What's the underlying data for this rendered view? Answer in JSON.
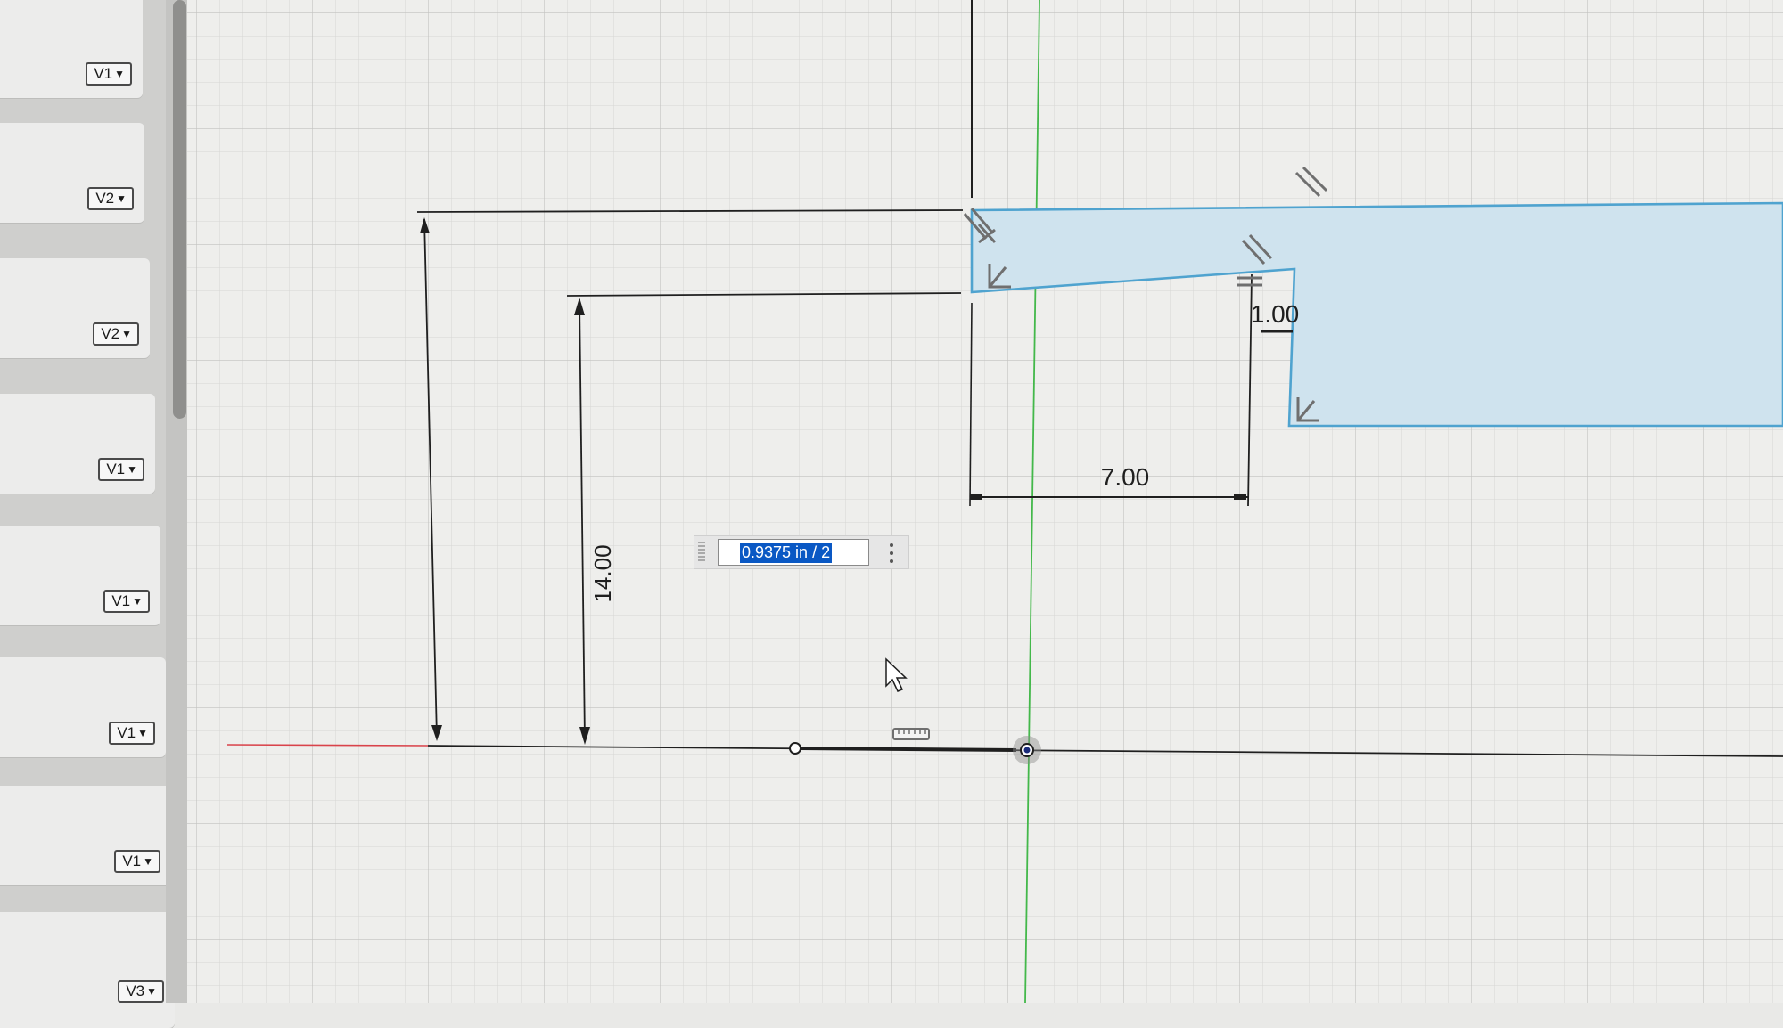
{
  "sidebar": {
    "versions": [
      "V1",
      "V2",
      "V2",
      "V1",
      "V1",
      "V1",
      "V1",
      "V3"
    ],
    "caret_icon": "triangle-down-icon"
  },
  "sketch": {
    "dimensions": {
      "vertical_overall": "14.00",
      "horizontal_lower": "7.00",
      "horizontal_small": "1.00"
    },
    "value_editor": {
      "value": "0.9375 in / 2",
      "menu_icon": "vertical-ellipsis-icon"
    },
    "colors": {
      "x_axis": "#d9434b",
      "y_axis": "#43b84a",
      "profile_fill": "#cfe3ee",
      "profile_edge": "#4fa3cf",
      "sketch_line": "#1f1f1f",
      "selection": "#0a58c4"
    }
  }
}
